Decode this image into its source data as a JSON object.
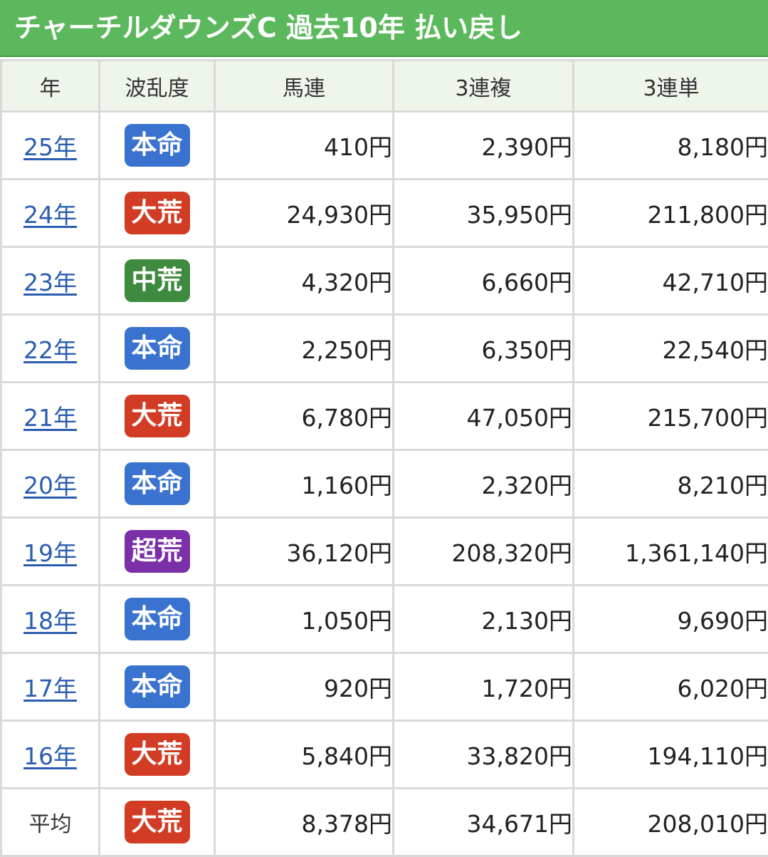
{
  "title": "チャーチルダウンズC 過去10年 払い戻し",
  "headers": {
    "year": "年",
    "level": "波乱度",
    "umaren": "馬連",
    "sanrenpuku": "3連複",
    "sanrentan": "3連単"
  },
  "level_colors": {
    "本命": "#3a73cf",
    "大荒": "#d23c25",
    "中荒": "#3e8a3e",
    "超荒": "#7b2fa8"
  },
  "rows": [
    {
      "year": "25年",
      "level": "本命",
      "umaren": "410円",
      "sanrenpuku": "2,390円",
      "sanrentan": "8,180円"
    },
    {
      "year": "24年",
      "level": "大荒",
      "umaren": "24,930円",
      "sanrenpuku": "35,950円",
      "sanrentan": "211,800円"
    },
    {
      "year": "23年",
      "level": "中荒",
      "umaren": "4,320円",
      "sanrenpuku": "6,660円",
      "sanrentan": "42,710円"
    },
    {
      "year": "22年",
      "level": "本命",
      "umaren": "2,250円",
      "sanrenpuku": "6,350円",
      "sanrentan": "22,540円"
    },
    {
      "year": "21年",
      "level": "大荒",
      "umaren": "6,780円",
      "sanrenpuku": "47,050円",
      "sanrentan": "215,700円"
    },
    {
      "year": "20年",
      "level": "本命",
      "umaren": "1,160円",
      "sanrenpuku": "2,320円",
      "sanrentan": "8,210円"
    },
    {
      "year": "19年",
      "level": "超荒",
      "umaren": "36,120円",
      "sanrenpuku": "208,320円",
      "sanrentan": "1,361,140円"
    },
    {
      "year": "18年",
      "level": "本命",
      "umaren": "1,050円",
      "sanrenpuku": "2,130円",
      "sanrentan": "9,690円"
    },
    {
      "year": "17年",
      "level": "本命",
      "umaren": "920円",
      "sanrenpuku": "1,720円",
      "sanrentan": "6,020円"
    },
    {
      "year": "16年",
      "level": "大荒",
      "umaren": "5,840円",
      "sanrenpuku": "33,820円",
      "sanrentan": "194,110円"
    }
  ],
  "average": {
    "label": "平均",
    "level": "大荒",
    "umaren": "8,378円",
    "sanrenpuku": "34,671円",
    "sanrentan": "208,010円"
  }
}
